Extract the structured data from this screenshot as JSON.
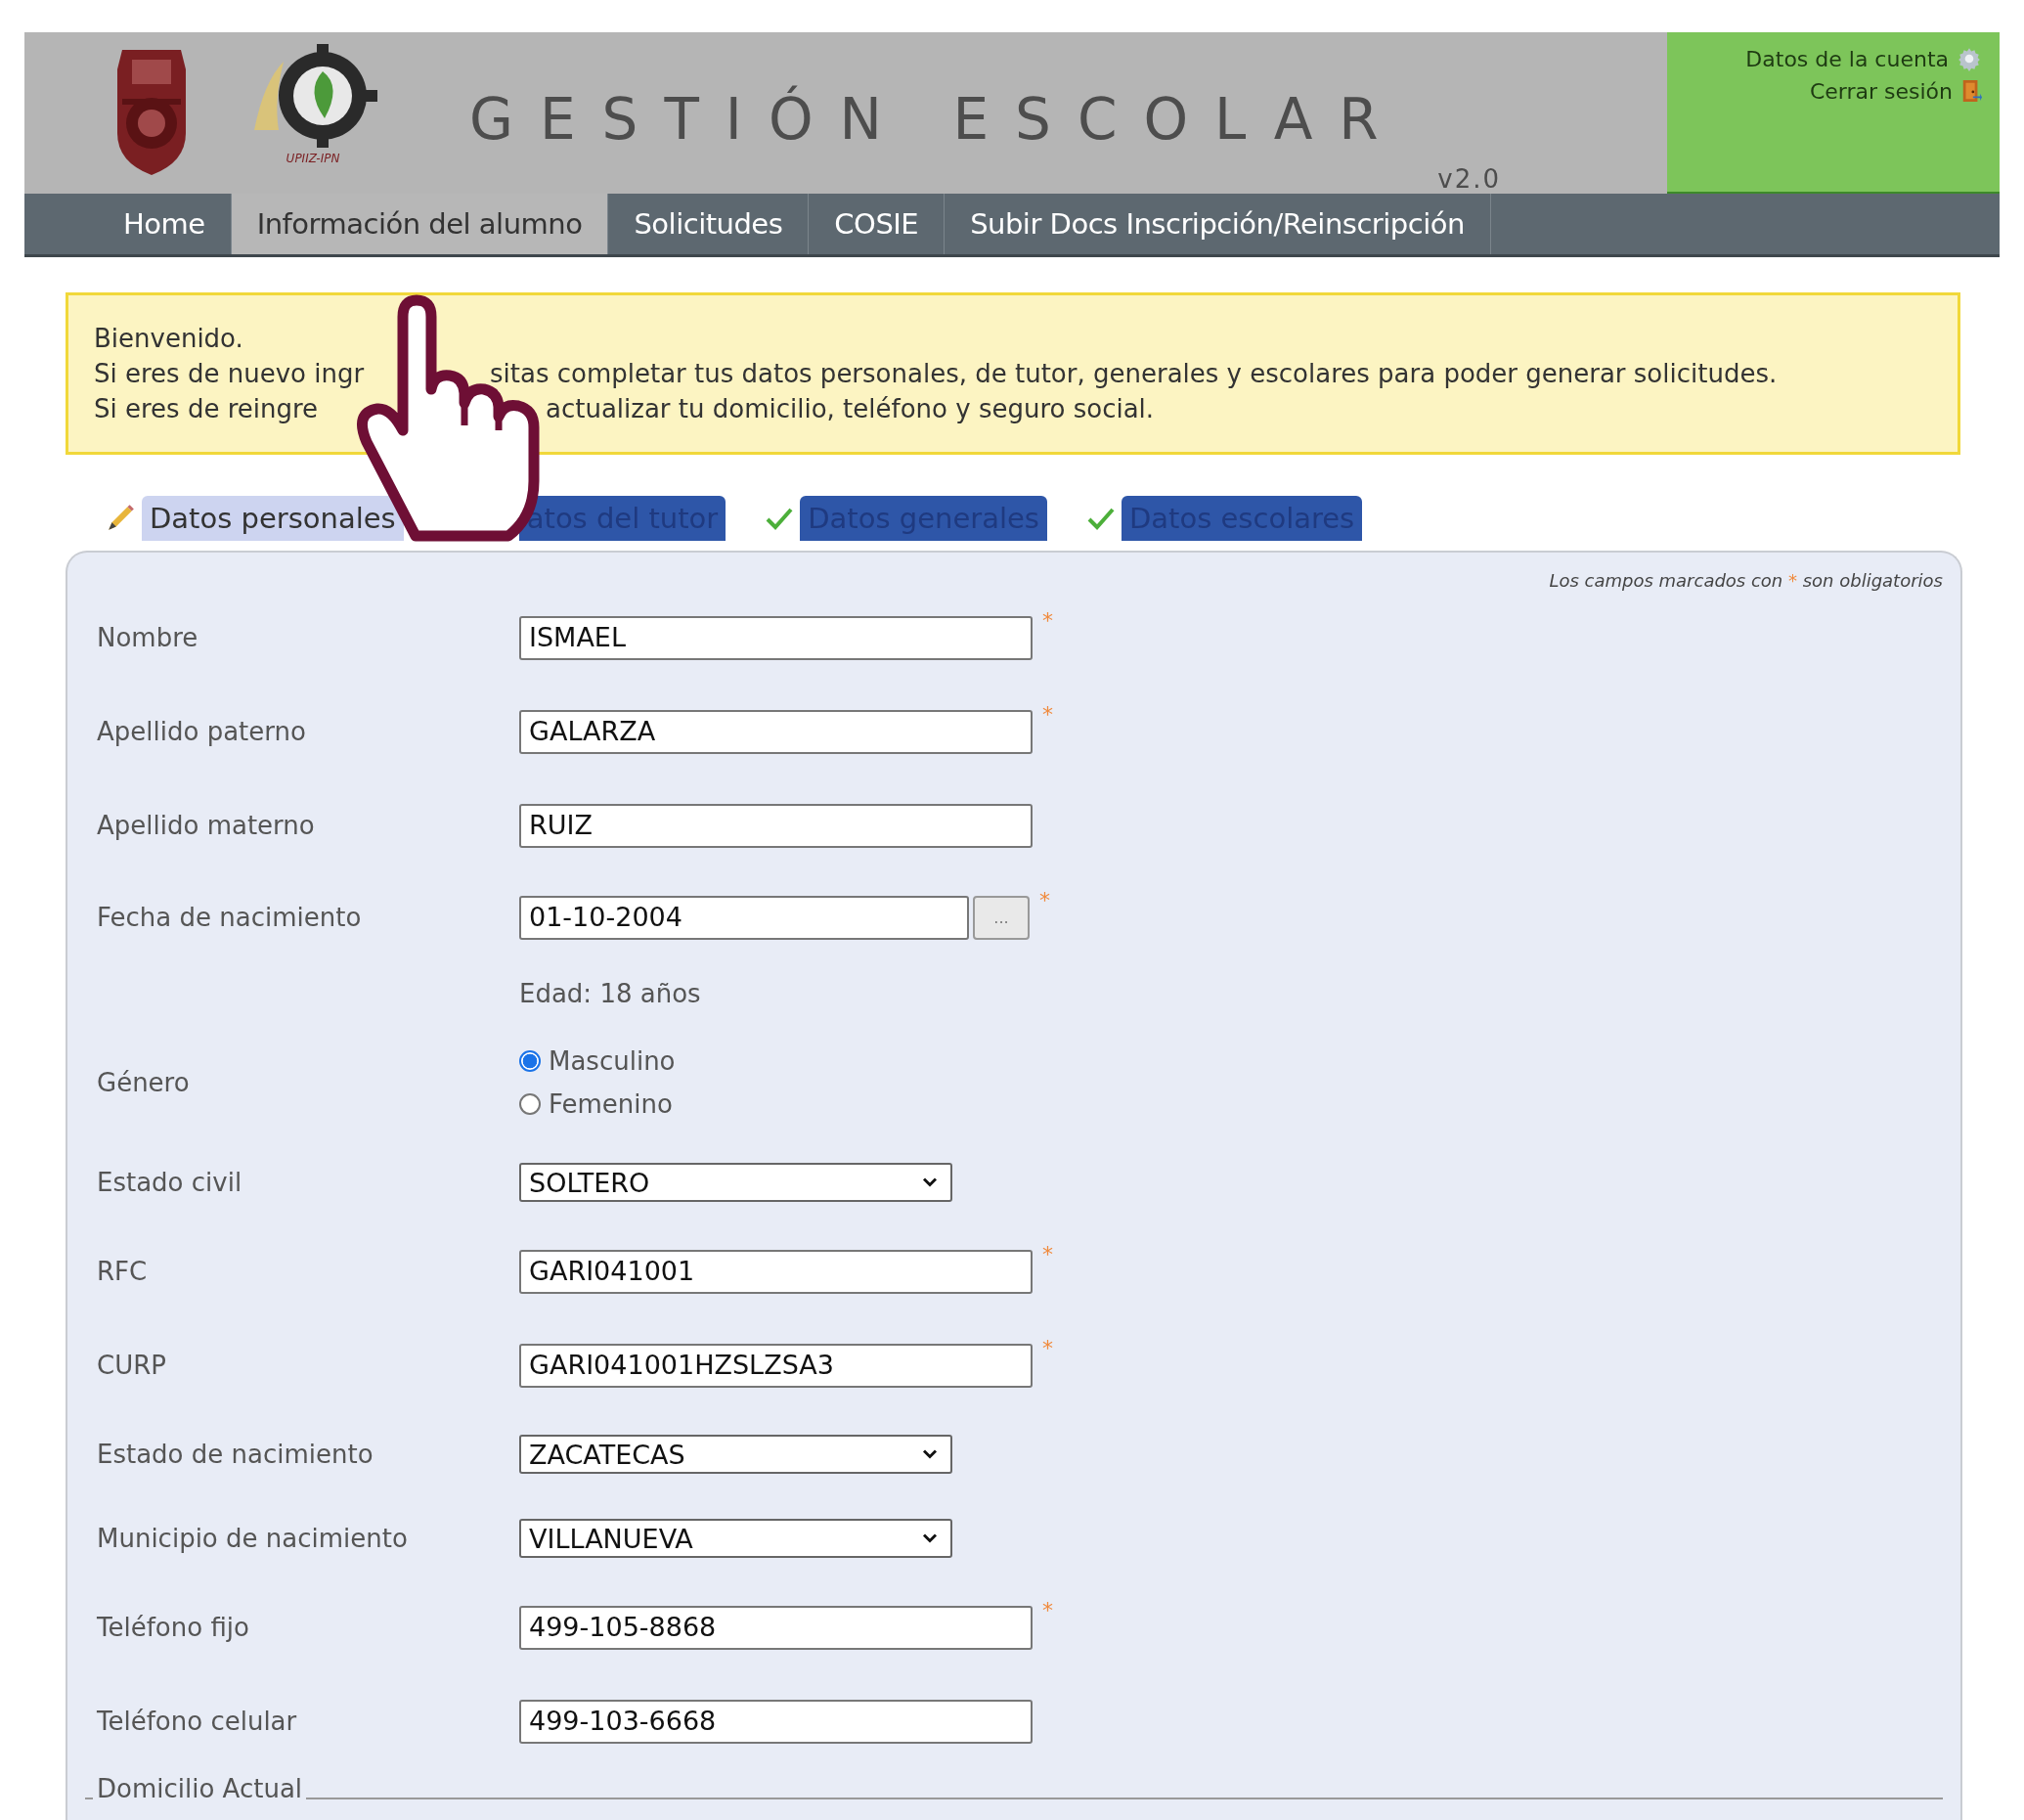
{
  "header": {
    "logo_caption": "UPIIZ-IPN",
    "title": "GESTIÓN ESCOLAR",
    "version": "v2.0",
    "account_links": [
      {
        "label": "Datos de la cuenta",
        "kind": "settings"
      },
      {
        "label": "Cerrar sesión",
        "kind": "logout"
      }
    ]
  },
  "nav": [
    {
      "label": "Home",
      "selected": false
    },
    {
      "label": "Información del alumno",
      "selected": true
    },
    {
      "label": "Solicitudes",
      "selected": false
    },
    {
      "label": "COSIE",
      "selected": false
    },
    {
      "label": "Subir Docs Inscripción/Reinscripción",
      "selected": false
    }
  ],
  "notice": {
    "lines": [
      {
        "parts": [
          "Bienvenido."
        ]
      },
      {
        "parts": [
          "Si eres de nuevo ingr",
          "sitas completar tus datos personales, de tutor, generales y escolares para poder generar solicitudes."
        ]
      },
      {
        "parts": [
          "Si eres de reingre",
          "actualizar tu domicilio, teléfono y seguro social."
        ]
      }
    ]
  },
  "tabs": [
    {
      "label": "Datos personales",
      "selected": true,
      "completed": false
    },
    {
      "label": "atos del tutor",
      "selected": false,
      "completed": false
    },
    {
      "label": "Datos generales",
      "selected": false,
      "completed": true
    },
    {
      "label": "Datos escolares",
      "selected": false,
      "completed": true
    }
  ],
  "form": {
    "required_note": {
      "before": "Los campos marcados con",
      "mark": "*",
      "after": "son obligatorios"
    },
    "fields": [
      {
        "kind": "text",
        "label": "Nombre",
        "value": "ISMAEL",
        "required_mark": "*"
      },
      {
        "kind": "text",
        "label": "Apellido paterno",
        "value": "GALARZA",
        "required_mark": "*"
      },
      {
        "kind": "text",
        "label": "Apellido materno",
        "value": "RUIZ"
      },
      {
        "kind": "date",
        "label": "Fecha de nacimiento",
        "value": "01-10-2004",
        "picker_button": "...",
        "required_mark": "*"
      },
      {
        "kind": "info",
        "value": "Edad: 18 años"
      },
      {
        "kind": "radio",
        "label": "Género",
        "options": [
          {
            "label": "Masculino",
            "selected": true
          },
          {
            "label": "Femenino",
            "selected": false
          }
        ]
      },
      {
        "kind": "select",
        "label": "Estado civil",
        "value": "SOLTERO"
      },
      {
        "kind": "text",
        "label": "RFC",
        "value": "GARI041001",
        "required_mark": "*"
      },
      {
        "kind": "text",
        "label": "CURP",
        "value": "GARI041001HZSLZSA3",
        "required_mark": "*"
      },
      {
        "kind": "select",
        "label": "Estado de nacimiento",
        "value": "ZACATECAS"
      },
      {
        "kind": "select",
        "label": "Municipio de nacimiento",
        "value": "VILLANUEVA"
      },
      {
        "kind": "text",
        "label": "Teléfono fijo",
        "value": "499-105-8868",
        "required_mark": "*"
      },
      {
        "kind": "text",
        "label": "Teléfono celular",
        "value": "499-103-6668"
      }
    ],
    "section": "Domicilio Actual"
  }
}
